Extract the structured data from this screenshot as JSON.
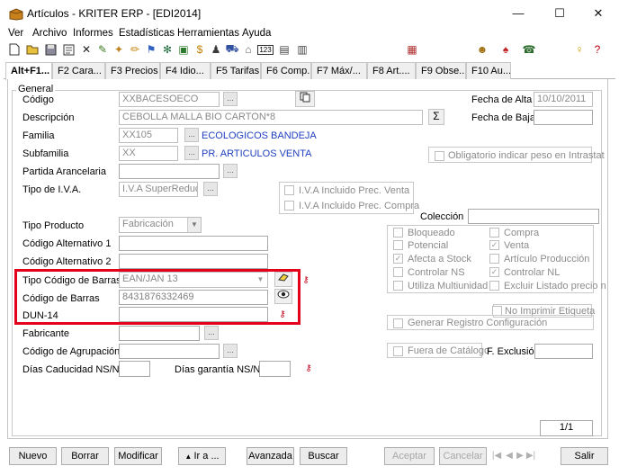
{
  "window": {
    "title": "Artículos - KRITER ERP - [EDI2014]",
    "minimize": "—",
    "maximize": "☐",
    "close": "✕"
  },
  "menu": [
    "Ver",
    "Archivo",
    "Informes",
    "Estadísticas",
    "Herramientas",
    "Ayuda"
  ],
  "tabs": [
    "Alt+F1...",
    "F2 Cara...",
    "F3 Precios",
    "F4 Idio...",
    "F5 Tarifas",
    "F6 Comp...",
    "F7 Máx/...",
    "F8 Art....",
    "F9 Obse...",
    "F10 Au..."
  ],
  "section_label": "General",
  "fields": {
    "codigo": {
      "label": "Código",
      "value": "XXBACESOECO"
    },
    "descripcion": {
      "label": "Descripción",
      "value": "CEBOLLA MALLA BIO CARTON*8"
    },
    "familia": {
      "label": "Familia",
      "value": "XX105",
      "desc": "ECOLOGICOS BANDEJA"
    },
    "subfamilia": {
      "label": "Subfamilia",
      "value": "XX",
      "desc": "PR. ARTICULOS VENTA"
    },
    "partida": {
      "label": "Partida Arancelaria",
      "value": ""
    },
    "tipo_iva": {
      "label": "Tipo de I.V.A.",
      "value": "I.V.A SuperReducido"
    },
    "tipo_producto": {
      "label": "Tipo Producto",
      "value": "Fabricación"
    },
    "cod_alt1": {
      "label": "Código Alternativo 1",
      "value": ""
    },
    "cod_alt2": {
      "label": "Código Alternativo 2",
      "value": ""
    },
    "tipo_codbarras": {
      "label": "Tipo Código de Barras",
      "value": "EAN/JAN 13"
    },
    "codbarras": {
      "label": "Código de Barras",
      "value": "8431876332469"
    },
    "dun14": {
      "label": "DUN-14",
      "value": ""
    },
    "fabricante": {
      "label": "Fabricante",
      "value": ""
    },
    "cod_agrupacion": {
      "label": "Código de Agrupación",
      "value": ""
    },
    "dias_caducidad": {
      "label": "Días Caducidad NS/NL.",
      "value": ""
    },
    "dias_garantia": {
      "label": "Días garantía NS/NL.",
      "value": ""
    },
    "fecha_alta": {
      "label": "Fecha de Alta",
      "value": "10/10/2011"
    },
    "fecha_baja": {
      "label": "Fecha de Baja",
      "value": ""
    },
    "coleccion": {
      "label": "Colección",
      "value": ""
    },
    "f_exclusion": {
      "label": "F. Exclusión",
      "value": ""
    }
  },
  "checkboxes": {
    "obligatorio_peso": {
      "label": "Obligatorio indicar peso en Intrastat",
      "checked": false
    },
    "iva_venta": {
      "label": "I.V.A Incluido Prec. Venta",
      "checked": false
    },
    "iva_compra": {
      "label": "I.V.A Incluido Prec. Compra",
      "checked": false
    },
    "bloqueado": {
      "label": "Bloqueado",
      "checked": false
    },
    "compra": {
      "label": "Compra",
      "checked": false
    },
    "potencial": {
      "label": "Potencial",
      "checked": false
    },
    "venta": {
      "label": "Venta",
      "checked": true
    },
    "afecta_stock": {
      "label": "Afecta a Stock",
      "checked": true
    },
    "articulo_produccion": {
      "label": "Artículo Producción",
      "checked": false
    },
    "controlar_ns": {
      "label": "Controlar NS",
      "checked": false
    },
    "controlar_nl": {
      "label": "Controlar NL",
      "checked": true
    },
    "utiliza_multiunidad": {
      "label": "Utiliza Multiunidad",
      "checked": false
    },
    "excluir_listado": {
      "label": "Excluir Listado precio n",
      "checked": false
    },
    "no_imprimir": {
      "label": "No Imprimir Etiqueta",
      "checked": false
    },
    "generar_registro": {
      "label": "Generar Registro Configuración",
      "checked": false
    },
    "fuera_catalogo": {
      "label": "Fuera de Catálogo",
      "checked": false
    }
  },
  "record_counter": "1/1",
  "buttons": {
    "nuevo": "Nuevo",
    "borrar": "Borrar",
    "modificar": "Modificar",
    "ira": "Ir a ...",
    "avanzada": "Avanzada",
    "buscar": "Buscar",
    "aceptar": "Aceptar",
    "cancelar": "Cancelar",
    "salir": "Salir"
  },
  "colors": {
    "highlight_border": "#e3001b",
    "link_blue": "#1f3fbf"
  }
}
